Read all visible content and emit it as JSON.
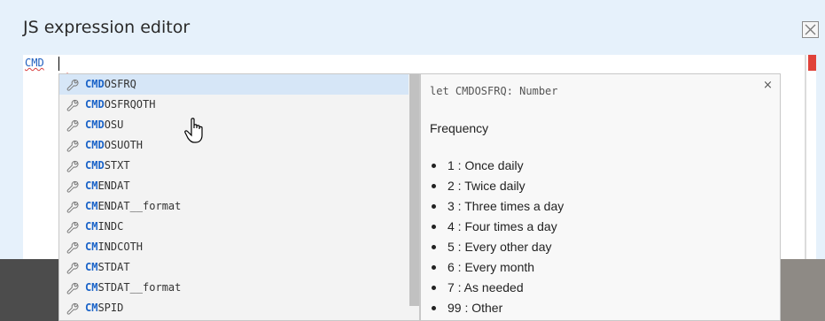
{
  "dialog": {
    "title": "JS expression editor"
  },
  "editor": {
    "code": "CMD"
  },
  "suggestions": {
    "items": [
      {
        "match": "CMD",
        "rest": "OSFRQ",
        "selected": true
      },
      {
        "match": "CMD",
        "rest": "OSFRQOTH"
      },
      {
        "match": "CMD",
        "rest": "OSU"
      },
      {
        "match": "CMD",
        "rest": "OSUOTH"
      },
      {
        "match": "CMD",
        "rest": "STXT"
      },
      {
        "match": "CM",
        "rest": "ENDAT"
      },
      {
        "match": "CM",
        "rest": "ENDAT__format"
      },
      {
        "match": "CM",
        "rest": "INDC"
      },
      {
        "match": "CM",
        "rest": "INDCOTH"
      },
      {
        "match": "CM",
        "rest": "STDAT"
      },
      {
        "match": "CM",
        "rest": "STDAT__format"
      },
      {
        "match": "CM",
        "rest": "SPID"
      }
    ],
    "icon": "wrench-icon"
  },
  "doc": {
    "signature": "let CMDOSFRQ: Number",
    "close": "×",
    "description": "Frequency",
    "options": [
      "1 : Once daily",
      "2 : Twice daily",
      "3 : Three times a day",
      "4 : Four times a day",
      "5 : Every other day",
      "6 : Every month",
      "7 : As needed",
      "99 : Other"
    ]
  },
  "colors": {
    "dialog_bg": "#e6f1fb",
    "match": "#1a63c8",
    "selected_bg": "#d6e6f7",
    "error": "#e0423a"
  }
}
